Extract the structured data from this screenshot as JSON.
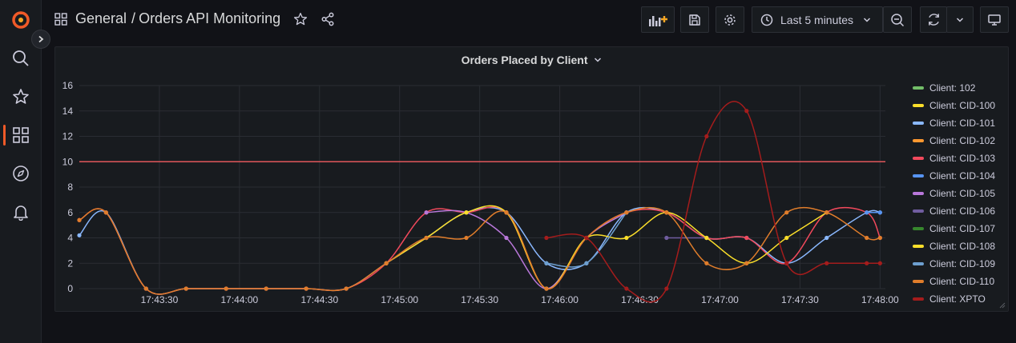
{
  "header": {
    "folder": "General",
    "separator": "/",
    "dashboard_title": "Orders API Monitoring",
    "time_range": "Last 5 minutes"
  },
  "panel": {
    "title": "Orders Placed by Client"
  },
  "colors": {
    "accent": "#f05a28",
    "threshold": "#e0575b"
  },
  "chart_data": {
    "type": "line",
    "title": "Orders Placed by Client",
    "x_ticks": [
      "17:43:30",
      "17:44:00",
      "17:44:30",
      "17:45:00",
      "17:45:30",
      "17:46:00",
      "17:46:30",
      "17:47:00",
      "17:47:30",
      "17:48:00"
    ],
    "y_ticks": [
      0,
      2,
      4,
      6,
      8,
      10,
      12,
      14,
      16
    ],
    "ylim": [
      0,
      16
    ],
    "xlim_seconds_from_1743": [
      0,
      302
    ],
    "threshold": 10,
    "grid": true,
    "legend_position": "right",
    "series": [
      {
        "name": "Client: 102",
        "color": "#73bf69",
        "x": [],
        "y": []
      },
      {
        "name": "Client: CID-100",
        "color": "#fade2a",
        "x": [],
        "y": []
      },
      {
        "name": "Client: CID-101",
        "color": "#8ab8ff",
        "x": [
          0,
          10,
          25,
          40,
          55,
          70,
          85,
          100,
          115,
          130,
          145,
          160,
          175,
          190,
          205,
          220,
          235,
          250,
          265,
          280,
          295,
          300
        ],
        "y": [
          4.2,
          6,
          0,
          0,
          0,
          0,
          0,
          0,
          2,
          4,
          6,
          6,
          2,
          2,
          6,
          6,
          4,
          4,
          2,
          4,
          6,
          6
        ]
      },
      {
        "name": "Client: CID-102",
        "color": "#ff9830",
        "x": [],
        "y": []
      },
      {
        "name": "Client: CID-103",
        "color": "#f2495c",
        "x": [
          0,
          10,
          25,
          40,
          55,
          70,
          85,
          100,
          115,
          130,
          145,
          160,
          175,
          190,
          205,
          220,
          235,
          250,
          265,
          280,
          295,
          300
        ],
        "y": [
          5.4,
          6,
          0,
          0,
          0,
          0,
          0,
          0,
          2,
          6,
          6,
          6,
          0,
          4,
          6,
          6,
          4,
          4,
          2,
          6,
          6,
          4
        ]
      },
      {
        "name": "Client: CID-104",
        "color": "#5794f2",
        "x": [
          295,
          300
        ],
        "y": [
          6,
          6
        ]
      },
      {
        "name": "Client: CID-105",
        "color": "#b877d9",
        "x": [
          130,
          145,
          160,
          175,
          190,
          205
        ],
        "y": [
          6,
          6,
          4,
          0,
          4,
          6
        ]
      },
      {
        "name": "Client: CID-106",
        "color": "#705da0",
        "x": [
          220,
          235
        ],
        "y": [
          4,
          4
        ]
      },
      {
        "name": "Client: CID-107",
        "color": "#37872d",
        "x": [],
        "y": []
      },
      {
        "name": "Client: CID-108",
        "color": "#fade2a",
        "x": [
          115,
          130,
          145,
          160,
          175,
          190,
          205,
          220,
          235,
          250,
          265,
          280
        ],
        "y": [
          2,
          4,
          6,
          6,
          0,
          4,
          4,
          6,
          4,
          2,
          4,
          6
        ]
      },
      {
        "name": "Client: CID-109",
        "color": "#6d9fcf",
        "x": [
          175,
          190,
          205
        ],
        "y": [
          2,
          2,
          6
        ]
      },
      {
        "name": "Client: CID-110",
        "color": "#e07d2b",
        "x": [
          0,
          10,
          25,
          40,
          55,
          70,
          85,
          100,
          115,
          130,
          145,
          160,
          175,
          190,
          205,
          220,
          235,
          250,
          265,
          280,
          295,
          300
        ],
        "y": [
          5.4,
          6,
          0,
          0,
          0,
          0,
          0,
          0,
          2,
          4,
          4,
          6,
          0,
          4,
          6,
          6,
          2,
          2,
          6,
          6,
          4,
          4
        ]
      },
      {
        "name": "Client: XPTO",
        "color": "#a51c1c",
        "x": [
          175,
          190,
          205,
          220,
          235,
          250,
          265,
          280,
          295,
          300
        ],
        "y": [
          4,
          4,
          0,
          0,
          12,
          14,
          2,
          2,
          2,
          2
        ]
      }
    ]
  }
}
